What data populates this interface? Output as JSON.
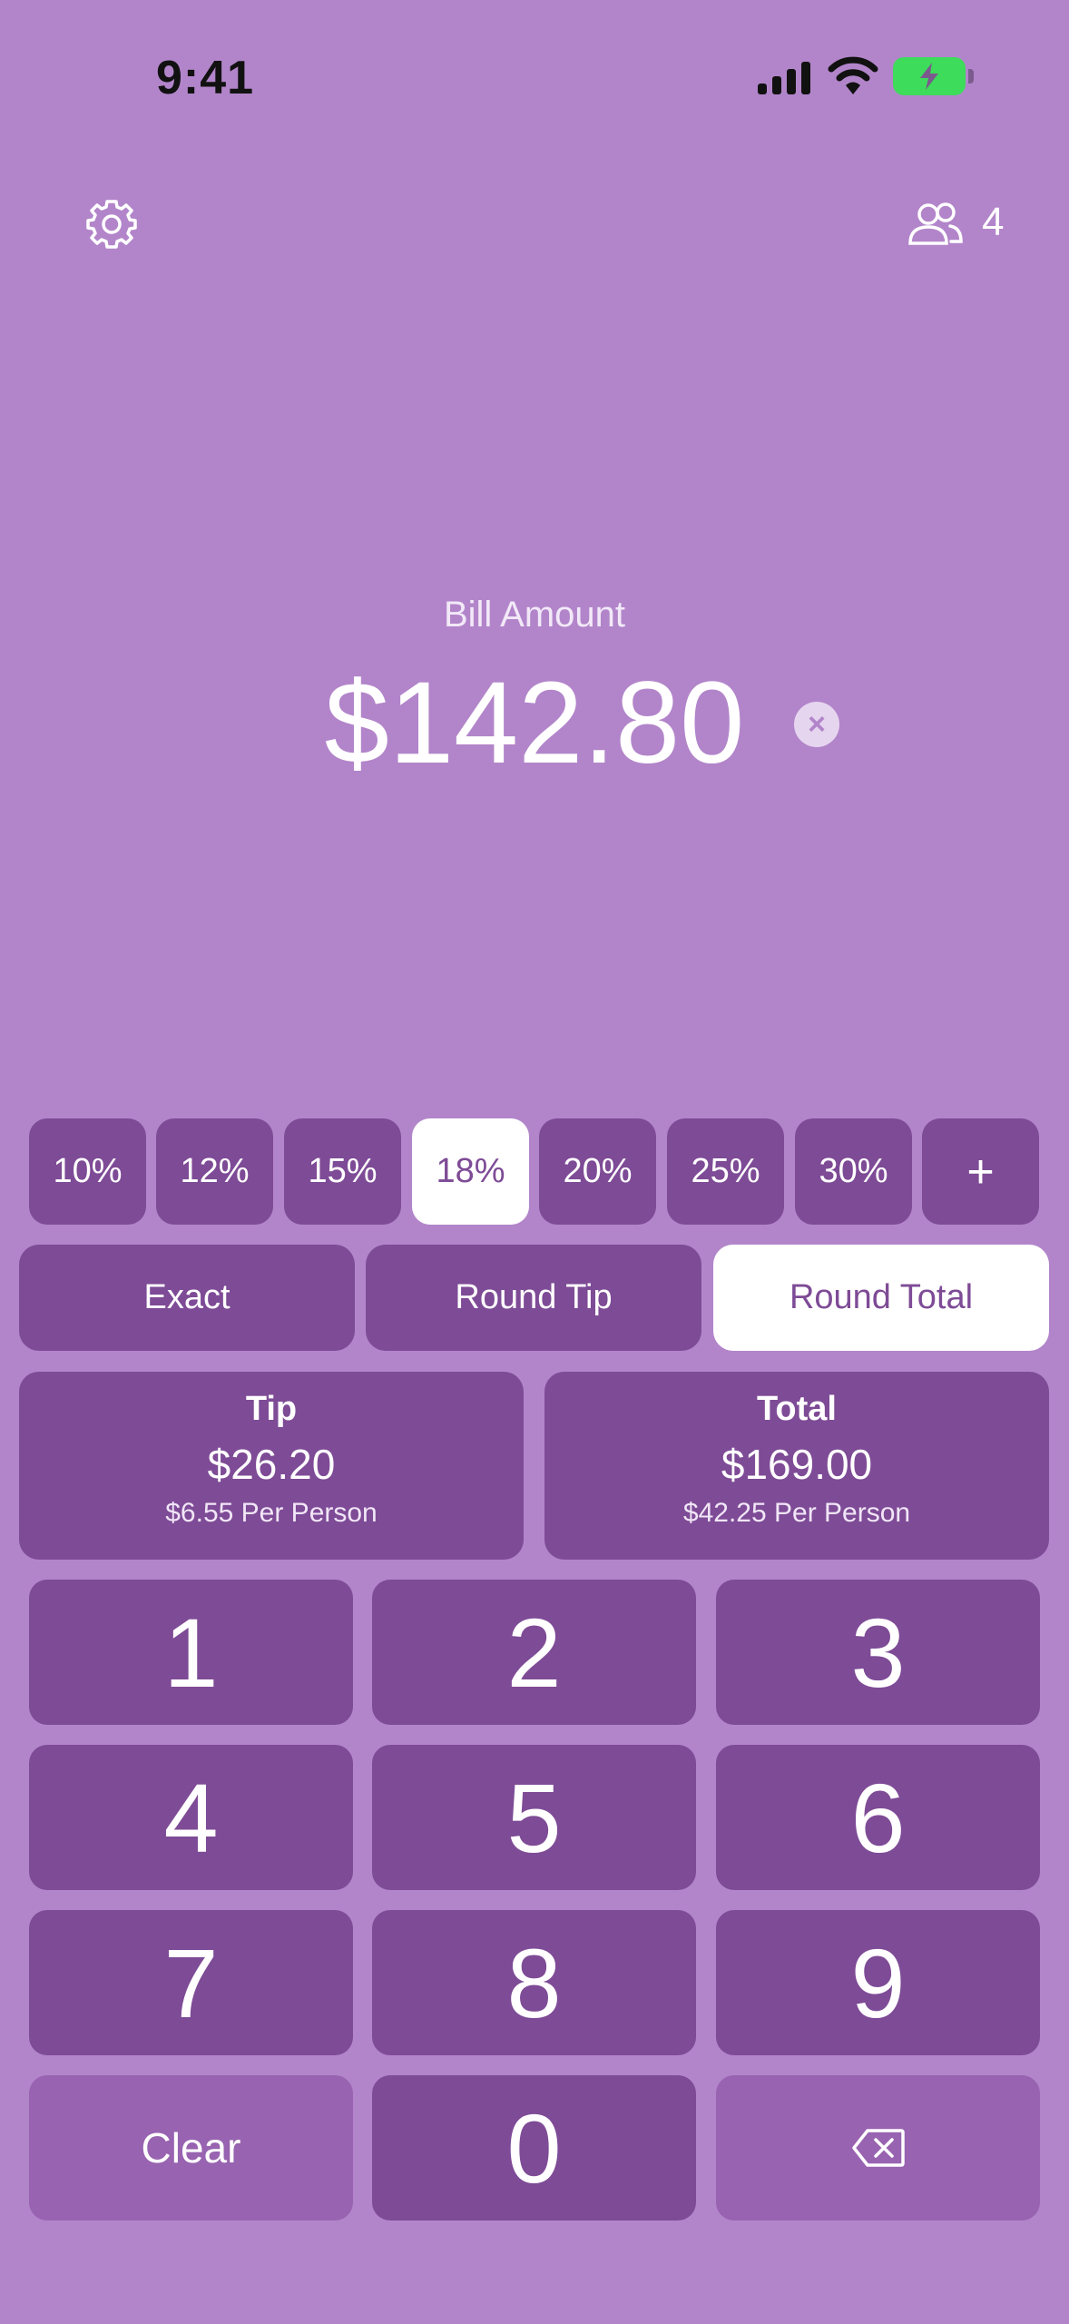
{
  "status_bar": {
    "time": "9:41"
  },
  "header": {
    "settings_icon": "gear-icon",
    "people_icon": "people-icon",
    "people_count": "4"
  },
  "bill": {
    "label": "Bill Amount",
    "amount": "$142.80",
    "clear_symbol": "×"
  },
  "tip_percentages": [
    {
      "label": "10%",
      "selected": false
    },
    {
      "label": "12%",
      "selected": false
    },
    {
      "label": "15%",
      "selected": false
    },
    {
      "label": "18%",
      "selected": true
    },
    {
      "label": "20%",
      "selected": false
    },
    {
      "label": "25%",
      "selected": false
    },
    {
      "label": "30%",
      "selected": false
    },
    {
      "label": "+",
      "selected": false
    }
  ],
  "rounding": [
    {
      "label": "Exact",
      "selected": false
    },
    {
      "label": "Round Tip",
      "selected": false
    },
    {
      "label": "Round Total",
      "selected": true
    }
  ],
  "results": {
    "tip": {
      "title": "Tip",
      "value": "$26.20",
      "per_person": "$6.55 Per Person"
    },
    "total": {
      "title": "Total",
      "value": "$169.00",
      "per_person": "$42.25 Per Person"
    }
  },
  "keypad": {
    "keys": [
      "1",
      "2",
      "3",
      "4",
      "5",
      "6",
      "7",
      "8",
      "9"
    ],
    "clear": "Clear",
    "zero": "0",
    "backspace_icon": "backspace-icon"
  },
  "colors": {
    "background": "#B285CA",
    "button": "#7E4B96",
    "button_light": "#9863B0",
    "selected": "#FFFFFF"
  }
}
